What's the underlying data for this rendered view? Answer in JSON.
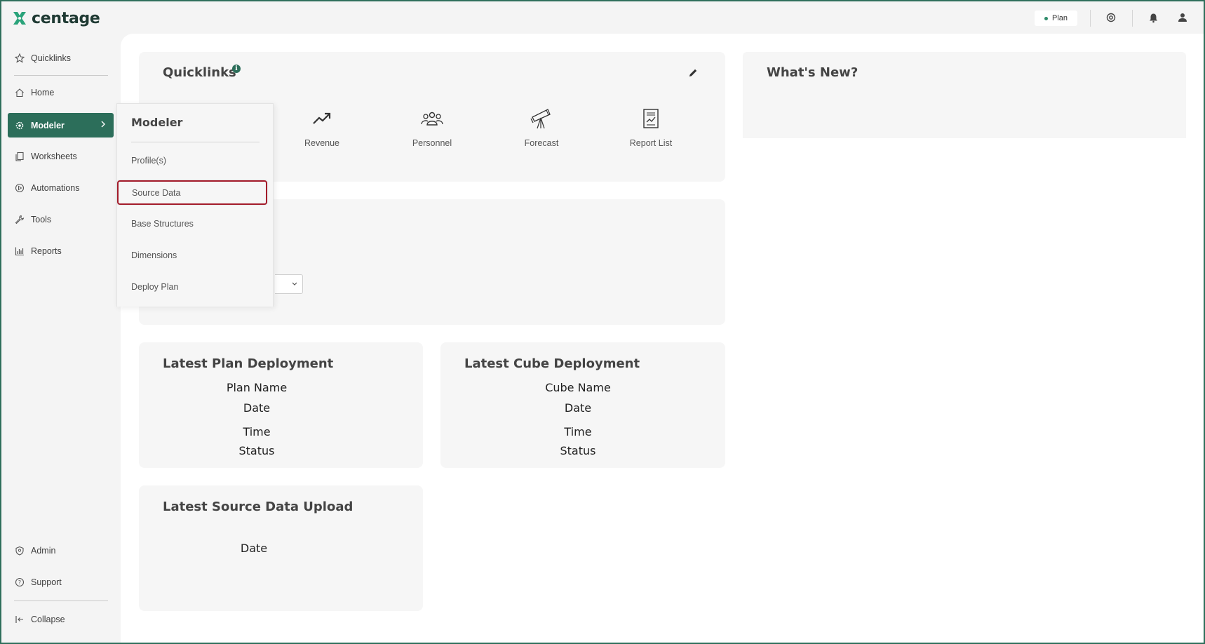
{
  "app": {
    "logo_text": "centage",
    "plan_badge": "Plan",
    "accent_color": "#2c6e5a",
    "highlight_color": "#a31b2a"
  },
  "sidebar": {
    "items": [
      {
        "label": "Quicklinks",
        "icon": "star-icon"
      },
      {
        "label": "Home",
        "icon": "home-icon"
      },
      {
        "label": "Modeler",
        "icon": "cube-gear-icon",
        "active": true
      },
      {
        "label": "Worksheets",
        "icon": "sheets-icon"
      },
      {
        "label": "Automations",
        "icon": "play-circle-icon"
      },
      {
        "label": "Tools",
        "icon": "wrench-icon"
      },
      {
        "label": "Reports",
        "icon": "bar-chart-icon"
      }
    ],
    "bottom_items": [
      {
        "label": "Admin",
        "icon": "shield-icon"
      },
      {
        "label": "Support",
        "icon": "help-icon"
      },
      {
        "label": "Collapse",
        "icon": "collapse-icon"
      }
    ]
  },
  "flyout": {
    "title": "Modeler",
    "items": [
      "Profile(s)",
      "Source Data",
      "Base Structures",
      "Dimensions",
      "Deploy Plan"
    ],
    "highlighted": "Source Data"
  },
  "quicklinks": {
    "title": "Quicklinks",
    "items": [
      {
        "label": "Revenue",
        "icon": "trend-up-icon"
      },
      {
        "label": "Personnel",
        "icon": "people-icon"
      },
      {
        "label": "Forecast",
        "icon": "telescope-icon"
      },
      {
        "label": "Report List",
        "icon": "report-icon"
      }
    ]
  },
  "whats_new": {
    "title": "What's New?"
  },
  "plan_deployment": {
    "title": "Latest Plan Deployment",
    "fields": [
      "Plan Name",
      "Date",
      "Time",
      "Status"
    ]
  },
  "cube_deployment": {
    "title": "Latest Cube Deployment",
    "fields": [
      "Cube Name",
      "Date",
      "Time",
      "Status"
    ]
  },
  "source_upload": {
    "title": "Latest Source Data Upload",
    "fields": [
      "Date"
    ]
  }
}
